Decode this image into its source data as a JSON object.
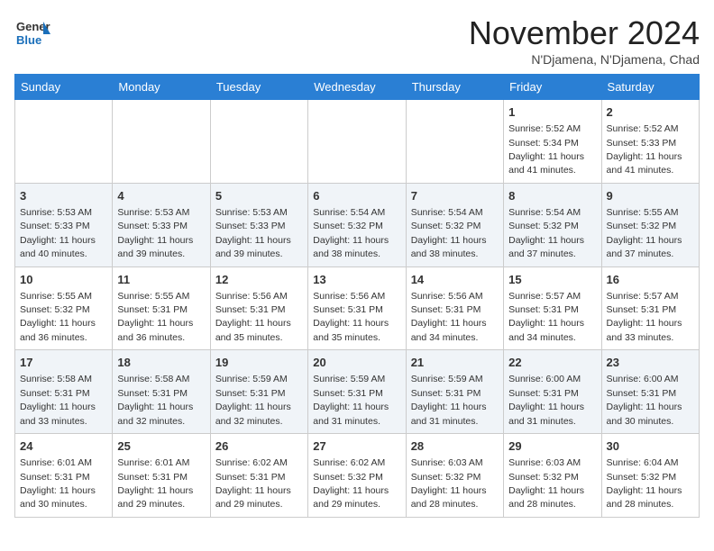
{
  "header": {
    "logo_general": "General",
    "logo_blue": "Blue",
    "month_title": "November 2024",
    "location": "N'Djamena, N'Djamena, Chad"
  },
  "days_of_week": [
    "Sunday",
    "Monday",
    "Tuesday",
    "Wednesday",
    "Thursday",
    "Friday",
    "Saturday"
  ],
  "weeks": [
    [
      {
        "day": "",
        "info": ""
      },
      {
        "day": "",
        "info": ""
      },
      {
        "day": "",
        "info": ""
      },
      {
        "day": "",
        "info": ""
      },
      {
        "day": "",
        "info": ""
      },
      {
        "day": "1",
        "info": "Sunrise: 5:52 AM\nSunset: 5:34 PM\nDaylight: 11 hours and 41 minutes."
      },
      {
        "day": "2",
        "info": "Sunrise: 5:52 AM\nSunset: 5:33 PM\nDaylight: 11 hours and 41 minutes."
      }
    ],
    [
      {
        "day": "3",
        "info": "Sunrise: 5:53 AM\nSunset: 5:33 PM\nDaylight: 11 hours and 40 minutes."
      },
      {
        "day": "4",
        "info": "Sunrise: 5:53 AM\nSunset: 5:33 PM\nDaylight: 11 hours and 39 minutes."
      },
      {
        "day": "5",
        "info": "Sunrise: 5:53 AM\nSunset: 5:33 PM\nDaylight: 11 hours and 39 minutes."
      },
      {
        "day": "6",
        "info": "Sunrise: 5:54 AM\nSunset: 5:32 PM\nDaylight: 11 hours and 38 minutes."
      },
      {
        "day": "7",
        "info": "Sunrise: 5:54 AM\nSunset: 5:32 PM\nDaylight: 11 hours and 38 minutes."
      },
      {
        "day": "8",
        "info": "Sunrise: 5:54 AM\nSunset: 5:32 PM\nDaylight: 11 hours and 37 minutes."
      },
      {
        "day": "9",
        "info": "Sunrise: 5:55 AM\nSunset: 5:32 PM\nDaylight: 11 hours and 37 minutes."
      }
    ],
    [
      {
        "day": "10",
        "info": "Sunrise: 5:55 AM\nSunset: 5:32 PM\nDaylight: 11 hours and 36 minutes."
      },
      {
        "day": "11",
        "info": "Sunrise: 5:55 AM\nSunset: 5:31 PM\nDaylight: 11 hours and 36 minutes."
      },
      {
        "day": "12",
        "info": "Sunrise: 5:56 AM\nSunset: 5:31 PM\nDaylight: 11 hours and 35 minutes."
      },
      {
        "day": "13",
        "info": "Sunrise: 5:56 AM\nSunset: 5:31 PM\nDaylight: 11 hours and 35 minutes."
      },
      {
        "day": "14",
        "info": "Sunrise: 5:56 AM\nSunset: 5:31 PM\nDaylight: 11 hours and 34 minutes."
      },
      {
        "day": "15",
        "info": "Sunrise: 5:57 AM\nSunset: 5:31 PM\nDaylight: 11 hours and 34 minutes."
      },
      {
        "day": "16",
        "info": "Sunrise: 5:57 AM\nSunset: 5:31 PM\nDaylight: 11 hours and 33 minutes."
      }
    ],
    [
      {
        "day": "17",
        "info": "Sunrise: 5:58 AM\nSunset: 5:31 PM\nDaylight: 11 hours and 33 minutes."
      },
      {
        "day": "18",
        "info": "Sunrise: 5:58 AM\nSunset: 5:31 PM\nDaylight: 11 hours and 32 minutes."
      },
      {
        "day": "19",
        "info": "Sunrise: 5:59 AM\nSunset: 5:31 PM\nDaylight: 11 hours and 32 minutes."
      },
      {
        "day": "20",
        "info": "Sunrise: 5:59 AM\nSunset: 5:31 PM\nDaylight: 11 hours and 31 minutes."
      },
      {
        "day": "21",
        "info": "Sunrise: 5:59 AM\nSunset: 5:31 PM\nDaylight: 11 hours and 31 minutes."
      },
      {
        "day": "22",
        "info": "Sunrise: 6:00 AM\nSunset: 5:31 PM\nDaylight: 11 hours and 31 minutes."
      },
      {
        "day": "23",
        "info": "Sunrise: 6:00 AM\nSunset: 5:31 PM\nDaylight: 11 hours and 30 minutes."
      }
    ],
    [
      {
        "day": "24",
        "info": "Sunrise: 6:01 AM\nSunset: 5:31 PM\nDaylight: 11 hours and 30 minutes."
      },
      {
        "day": "25",
        "info": "Sunrise: 6:01 AM\nSunset: 5:31 PM\nDaylight: 11 hours and 29 minutes."
      },
      {
        "day": "26",
        "info": "Sunrise: 6:02 AM\nSunset: 5:31 PM\nDaylight: 11 hours and 29 minutes."
      },
      {
        "day": "27",
        "info": "Sunrise: 6:02 AM\nSunset: 5:32 PM\nDaylight: 11 hours and 29 minutes."
      },
      {
        "day": "28",
        "info": "Sunrise: 6:03 AM\nSunset: 5:32 PM\nDaylight: 11 hours and 28 minutes."
      },
      {
        "day": "29",
        "info": "Sunrise: 6:03 AM\nSunset: 5:32 PM\nDaylight: 11 hours and 28 minutes."
      },
      {
        "day": "30",
        "info": "Sunrise: 6:04 AM\nSunset: 5:32 PM\nDaylight: 11 hours and 28 minutes."
      }
    ]
  ]
}
